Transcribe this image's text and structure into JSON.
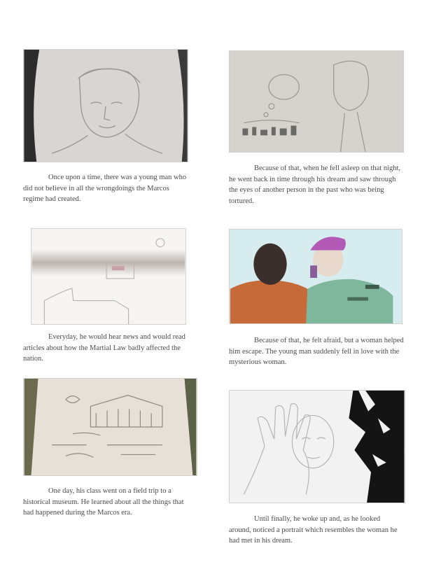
{
  "panels": [
    {
      "image": "sketch-young-man-portrait",
      "caption": "Once upon a time, there was a young man who did not believe in all the wrongdoings the Marcos regime had created."
    },
    {
      "image": "sketch-dream-thought-bubble",
      "caption": "Because of that, when he fell asleep on that night, he went back in time through his dream and saw through the eyes of another person in the past who was being tortured."
    },
    {
      "image": "sketch-news-tv-scene",
      "caption": "Everyday, he would hear news and would read articles about how the Martial Law badly affected the nation."
    },
    {
      "image": "sketch-soldier-and-prisoner",
      "caption": "Because of that, he felt afraid, but a woman helped him escape. The young man suddenly fell in love with the mysterious woman."
    },
    {
      "image": "sketch-museum-trip",
      "caption": "One day, his class went on a field trip to a historical museum. He learned about all the things that had happened during the Marcos era."
    },
    {
      "image": "sketch-hand-and-portrait",
      "caption": "Until finally, he woke up and, as he looked around, noticed a portrait which resembles the woman he had met in his dream."
    }
  ]
}
